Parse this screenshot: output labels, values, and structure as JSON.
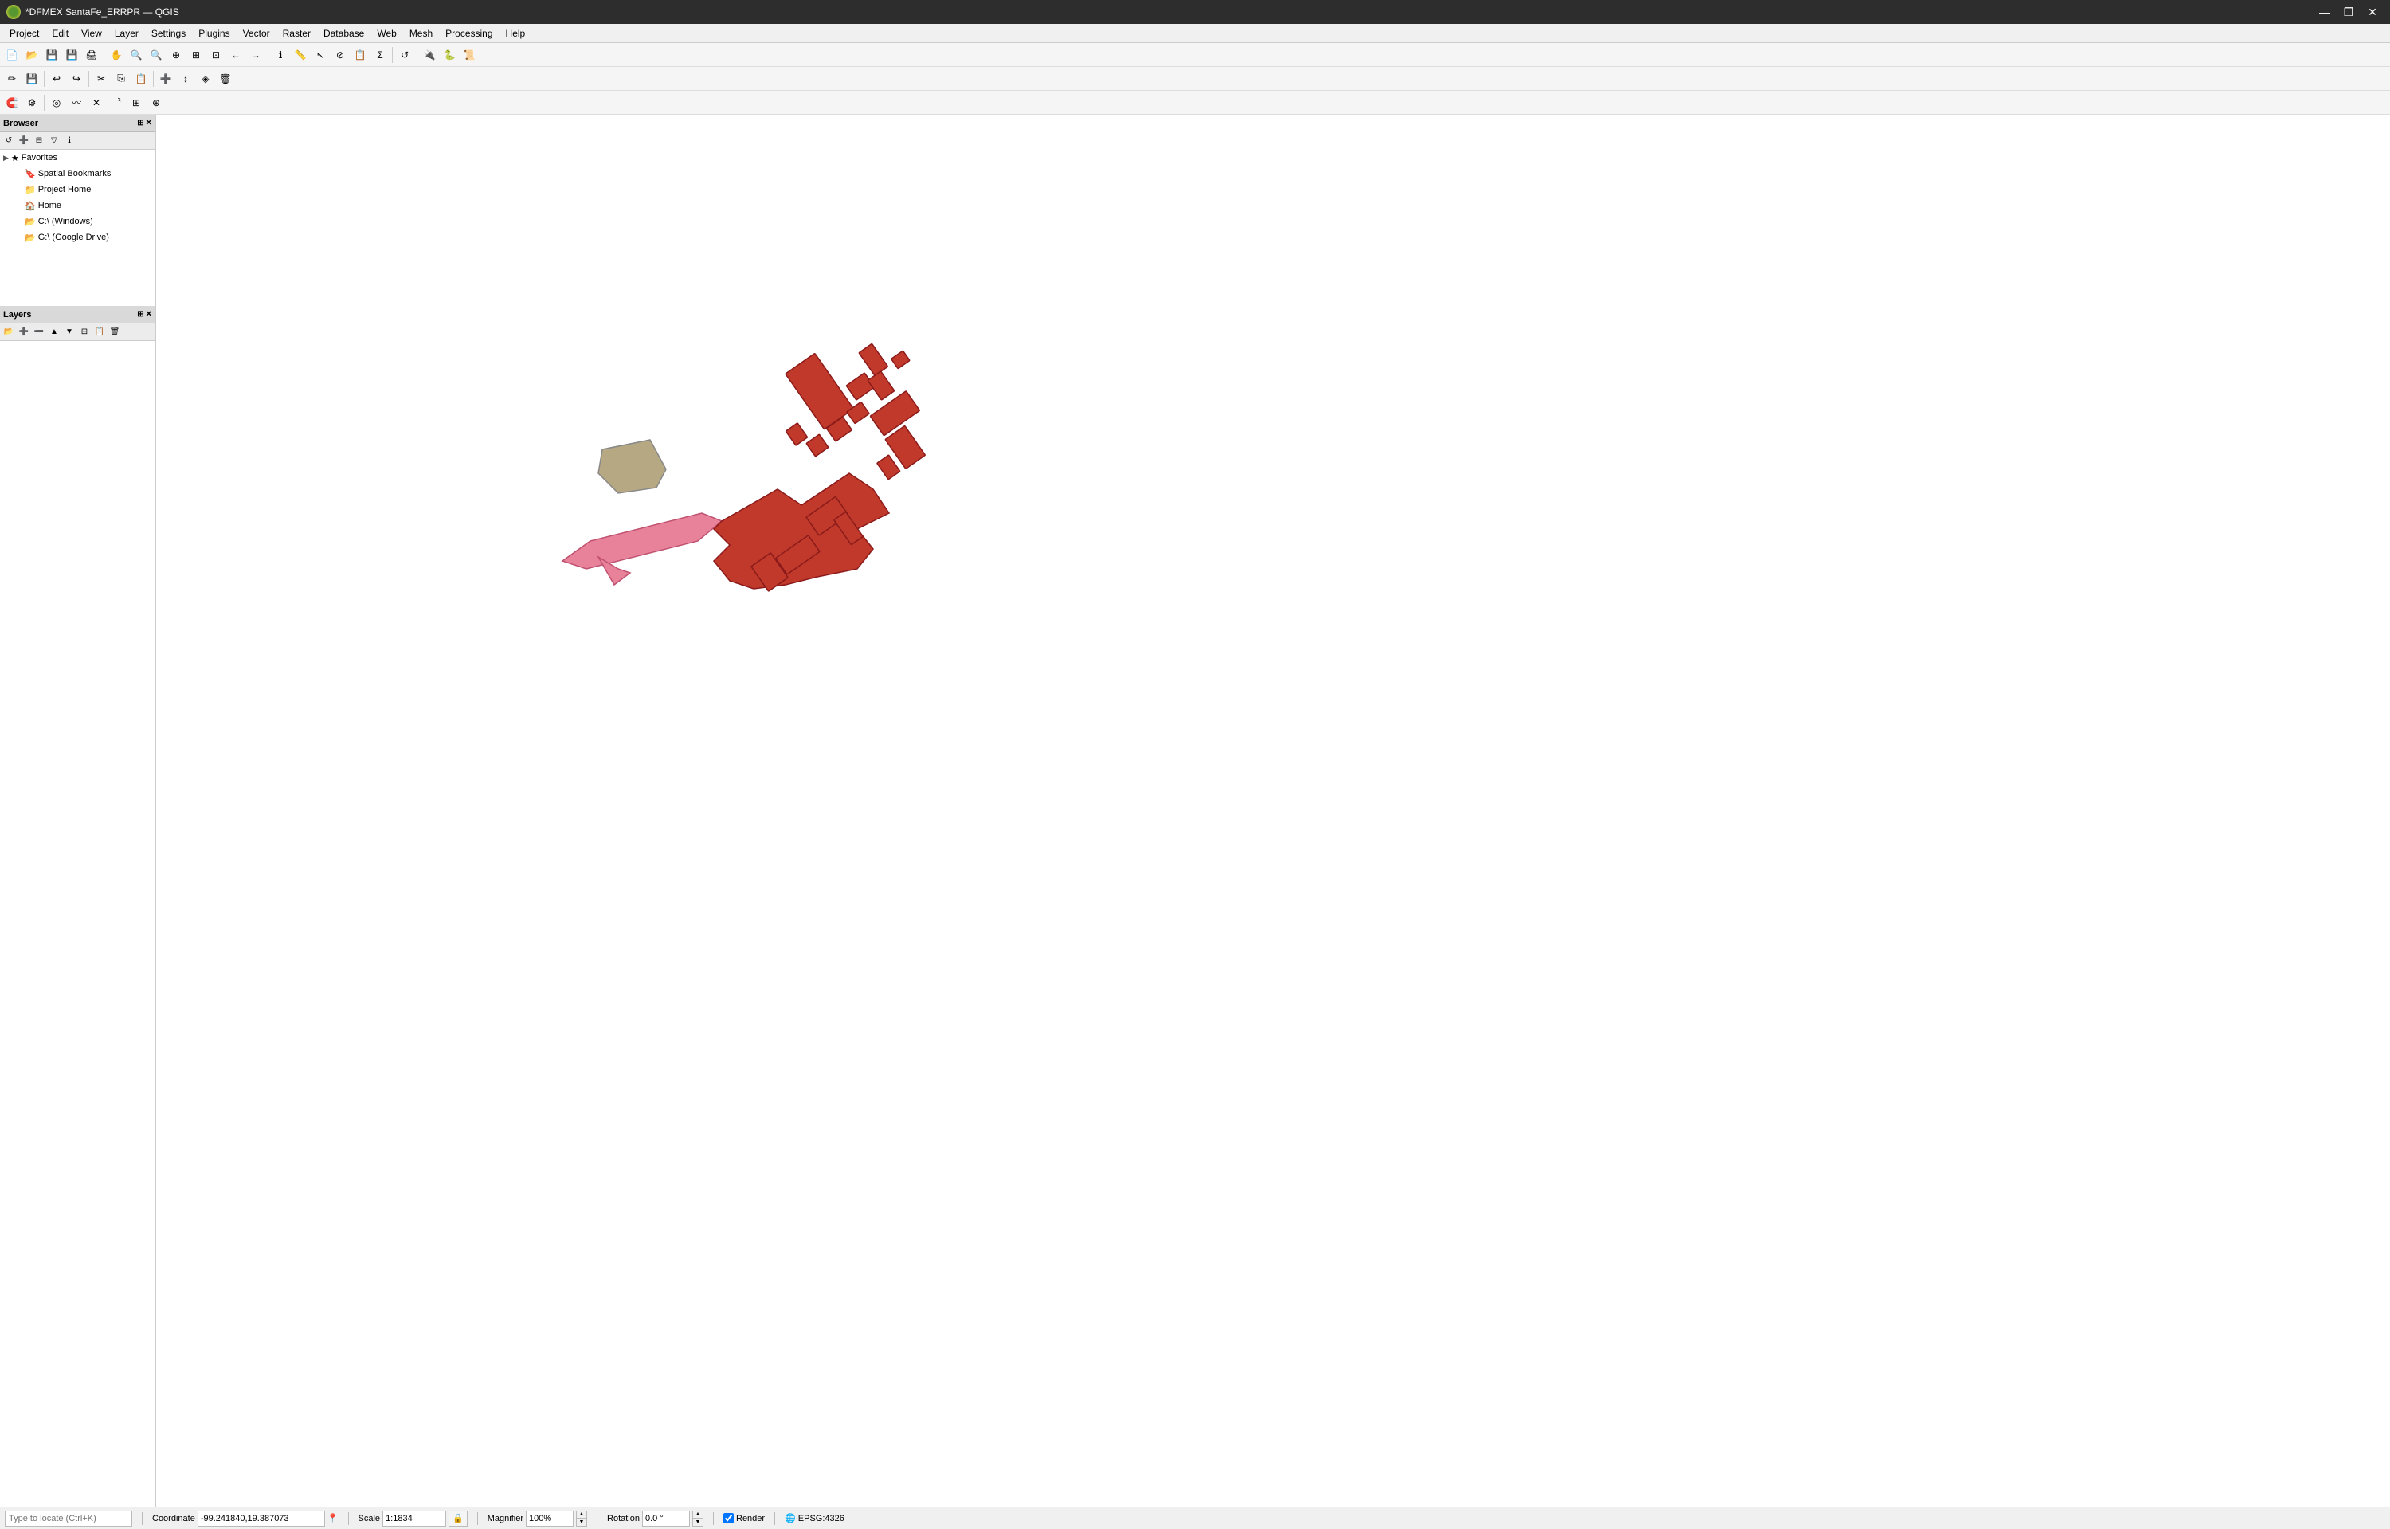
{
  "titlebar": {
    "title": "*DFMEX SantaFe_ERRPR — QGIS",
    "min_label": "—",
    "max_label": "❐",
    "close_label": "✕"
  },
  "menubar": {
    "items": [
      "Project",
      "Edit",
      "View",
      "Layer",
      "Settings",
      "Plugins",
      "Vector",
      "Raster",
      "Database",
      "Web",
      "Mesh",
      "Processing",
      "Help"
    ]
  },
  "browser_panel": {
    "title": "Browser",
    "tree_items": [
      {
        "label": "Favorites",
        "level": 1,
        "icon": "★",
        "has_arrow": true
      },
      {
        "label": "Spatial Bookmarks",
        "level": 2,
        "icon": "🔖",
        "has_arrow": false
      },
      {
        "label": "Project Home",
        "level": 2,
        "icon": "📁",
        "has_arrow": false
      },
      {
        "label": "Home",
        "level": 2,
        "icon": "🏠",
        "has_arrow": false
      },
      {
        "label": "C:\\ (Windows)",
        "level": 2,
        "icon": "📂",
        "has_arrow": false
      },
      {
        "label": "G:\\ (Google Drive)",
        "level": 2,
        "icon": "📂",
        "has_arrow": false
      }
    ]
  },
  "layers_panel": {
    "title": "Layers"
  },
  "statusbar": {
    "coordinate_label": "Coordinate",
    "coordinate_value": "-99.241840,19.387073",
    "scale_label": "Scale",
    "scale_value": "1:1834",
    "magnifier_label": "Magnifier",
    "magnifier_value": "100%",
    "rotation_label": "Rotation",
    "rotation_value": "0.0 °",
    "render_label": "Render",
    "epsg_label": "EPSG:4326",
    "search_placeholder": "Type to locate (Ctrl+K)"
  },
  "colors": {
    "buildings_red": "#c0392b",
    "buildings_red_fill": "#c0392b",
    "pink_building": "#e8829a",
    "tan_building": "#b5a882",
    "accent": "#0078d4"
  }
}
